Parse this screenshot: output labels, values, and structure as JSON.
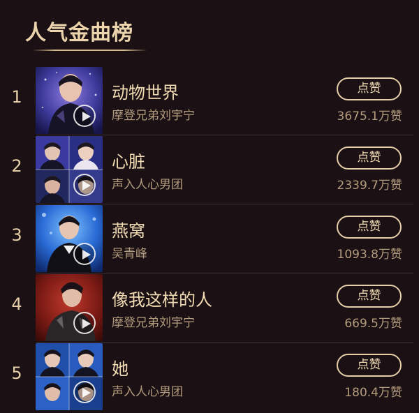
{
  "header": {
    "title": "人气金曲榜"
  },
  "songs": [
    {
      "rank": "1",
      "title": "动物世界",
      "artist": "摩登兄弟刘宇宁",
      "like_label": "点赞",
      "likes": "3675.1万赞"
    },
    {
      "rank": "2",
      "title": "心脏",
      "artist": "声入人心男团",
      "like_label": "点赞",
      "likes": "2339.7万赞"
    },
    {
      "rank": "3",
      "title": "燕窝",
      "artist": "吴青峰",
      "like_label": "点赞",
      "likes": "1093.8万赞"
    },
    {
      "rank": "4",
      "title": "像我这样的人",
      "artist": "摩登兄弟刘宇宁",
      "like_label": "点赞",
      "likes": "669.5万赞"
    },
    {
      "rank": "5",
      "title": "她",
      "artist": "声入人心男团",
      "like_label": "点赞",
      "likes": "180.4万赞"
    }
  ],
  "icons": {
    "play": "play-circle-icon"
  },
  "colors": {
    "background": "#1b1115",
    "accent_gold": "#e6cfa8",
    "muted": "#b49d7e"
  }
}
